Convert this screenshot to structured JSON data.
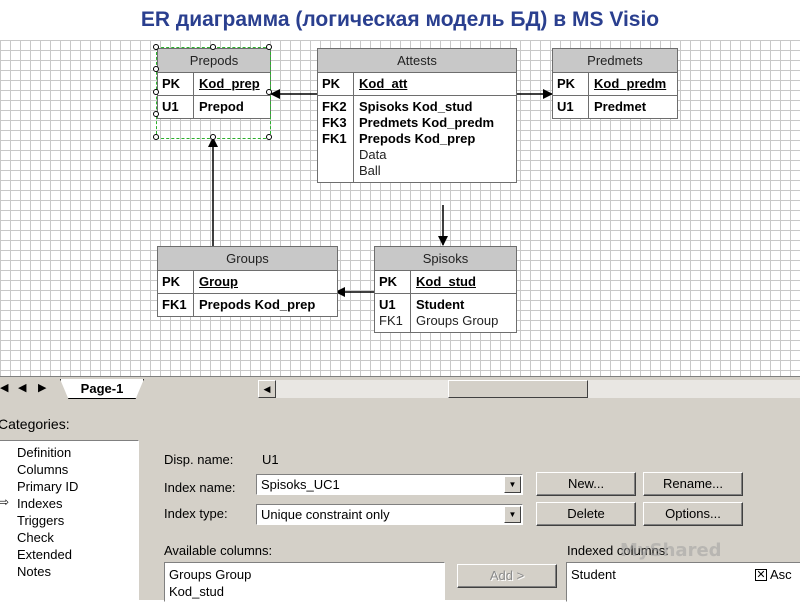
{
  "title": "ER диаграмма (логическая модель БД) в MS Visio",
  "entities": {
    "prepods": {
      "name": "Prepods",
      "pk_key": "PK",
      "pk_field": "Kod_prep",
      "u_key": "U1",
      "u_field": "Prepod"
    },
    "attests": {
      "name": "Attests",
      "pk_key": "PK",
      "pk_field": "Kod_att",
      "fk_keys": [
        "FK2",
        "FK3",
        "FK1"
      ],
      "fk_fields": [
        "Spisoks Kod_stud",
        "Predmets Kod_predm",
        "Prepods Kod_prep"
      ],
      "attrs": [
        "Data",
        "Ball"
      ]
    },
    "predmets": {
      "name": "Predmets",
      "pk_key": "PK",
      "pk_field": "Kod_predm",
      "u_key": "U1",
      "u_field": "Predmet"
    },
    "groups": {
      "name": "Groups",
      "pk_key": "PK",
      "pk_field": "Group",
      "fk_key": "FK1",
      "fk_field": "Prepods Kod_prep"
    },
    "spisoks": {
      "name": "Spisoks",
      "pk_key": "PK",
      "pk_field": "Kod_stud",
      "keys": [
        "U1",
        "FK1"
      ],
      "fields": [
        "Student",
        "Groups Group"
      ]
    }
  },
  "tabs": {
    "page": "Page-1"
  },
  "panel": {
    "categories_label": "Categories:",
    "categories": [
      "Definition",
      "Columns",
      "Primary ID",
      "Indexes",
      "Triggers",
      "Check",
      "Extended",
      "Notes"
    ],
    "selected_category": "Indexes",
    "disp_name_label": "Disp. name:",
    "disp_name_value": "U1",
    "index_name_label": "Index name:",
    "index_name_value": "Spisoks_UC1",
    "index_type_label": "Index type:",
    "index_type_value": "Unique constraint only",
    "buttons": {
      "new": "New...",
      "rename": "Rename...",
      "delete": "Delete",
      "options": "Options...",
      "add": "Add >"
    },
    "available_columns_label": "Available columns:",
    "available_columns": [
      "Groups Group",
      "Kod_stud"
    ],
    "indexed_columns_label": "Indexed columns:",
    "indexed_columns": [
      {
        "name": "Student",
        "order": "Asc",
        "checked": true
      }
    ]
  },
  "watermark": "MyShared"
}
